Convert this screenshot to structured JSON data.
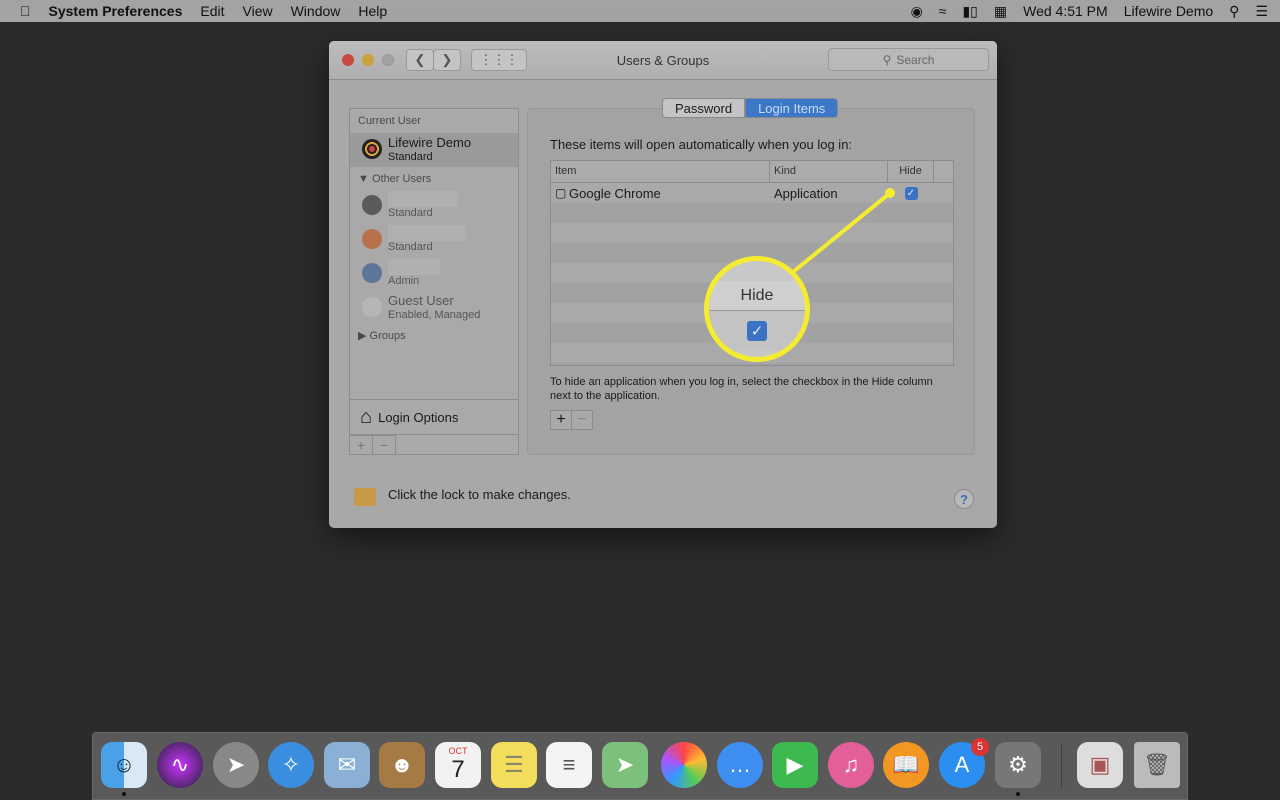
{
  "menubar": {
    "app": "System Preferences",
    "items": [
      "Edit",
      "View",
      "Window",
      "Help"
    ],
    "clock": "Wed 4:51 PM",
    "user": "Lifewire Demo"
  },
  "window": {
    "title": "Users & Groups",
    "search_placeholder": "Search",
    "sidebar": {
      "current_header": "Current User",
      "current_user": {
        "name": "Lifewire Demo",
        "role": "Standard"
      },
      "other_header": "Other Users",
      "others": [
        {
          "role": "Standard",
          "avatar_color": "#3a3a3a"
        },
        {
          "role": "Standard",
          "avatar_color": "#c0683a"
        },
        {
          "role": "Admin",
          "avatar_color": "#4a6a9a"
        },
        {
          "name": "Guest User",
          "role": "Enabled, Managed",
          "avatar_color": "#bdbdbd"
        }
      ],
      "groups": "Groups",
      "login_options": "Login Options"
    },
    "tabs": [
      {
        "label": "Password",
        "active": false
      },
      {
        "label": "Login Items",
        "active": true
      }
    ],
    "intro": "These items will open automatically when you log in:",
    "table": {
      "columns": [
        "Item",
        "Kind",
        "Hide"
      ],
      "rows": [
        {
          "item": "Google Chrome",
          "kind": "Application",
          "hide": true
        }
      ]
    },
    "note": "To hide an application when you log in, select the checkbox in the Hide column next to the application.",
    "add": "+",
    "remove": "−",
    "lock_text": "Click the lock to make changes.",
    "help": "?"
  },
  "callout": {
    "label": "Hide",
    "checked": true,
    "color": "#f5ec32"
  },
  "dock": {
    "items": [
      "Finder",
      "Siri",
      "Launchpad",
      "Safari",
      "Mail",
      "Contacts",
      "Calendar",
      "Notes",
      "Reminders",
      "Maps",
      "Photos",
      "Messages",
      "FaceTime",
      "iTunes",
      "iBooks",
      "App Store",
      "System Preferences",
      "Preview",
      "Trash"
    ],
    "calendar_month": "OCT",
    "calendar_day": "7",
    "app_store_badge": "5"
  }
}
